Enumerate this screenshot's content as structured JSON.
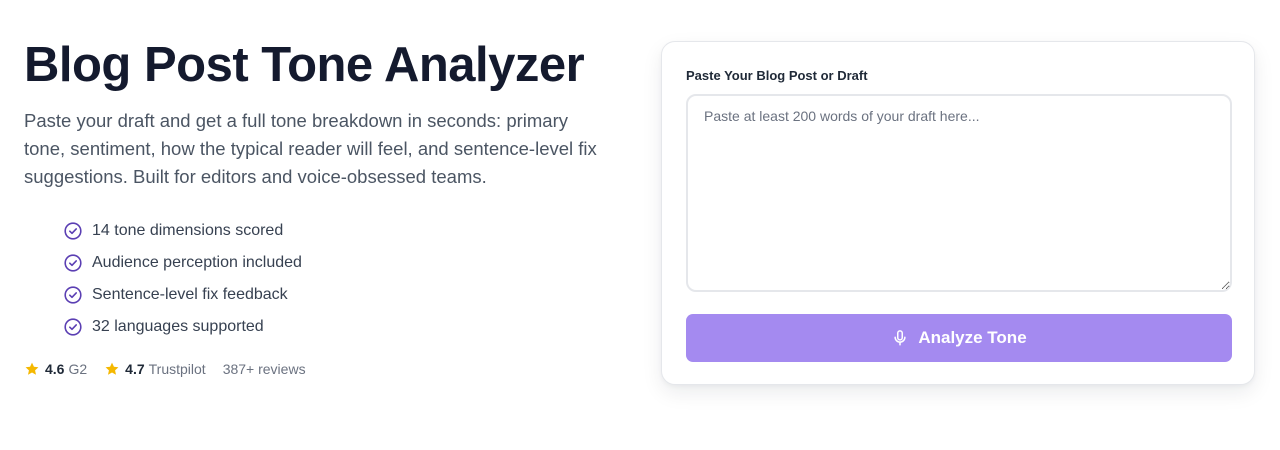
{
  "hero": {
    "title": "Blog Post Tone Analyzer",
    "description": "Paste your draft and get a full tone breakdown in seconds: primary tone, sentiment, how the typical reader will feel, and sentence-level fix suggestions. Built for editors and voice-obsessed teams.",
    "features": [
      "14 tone dimensions scored",
      "Audience perception included",
      "Sentence-level fix feedback",
      "32 languages supported"
    ],
    "ratings": {
      "g2_score": "4.6",
      "g2_label": "G2",
      "trustpilot_score": "4.7",
      "trustpilot_label": "Trustpilot",
      "reviews": "387+ reviews"
    }
  },
  "form": {
    "label": "Paste Your Blog Post or Draft",
    "placeholder": "Paste at least 200 words of your draft here...",
    "value": "",
    "button_label": "Analyze Tone"
  },
  "icons": {
    "feature": "check-circle-icon",
    "rating": "star-icon",
    "button": "microphone-icon"
  },
  "colors": {
    "accent": "#a48af0",
    "check": "#5b3fb3",
    "star": "#f5b800",
    "title": "#141a2e"
  }
}
